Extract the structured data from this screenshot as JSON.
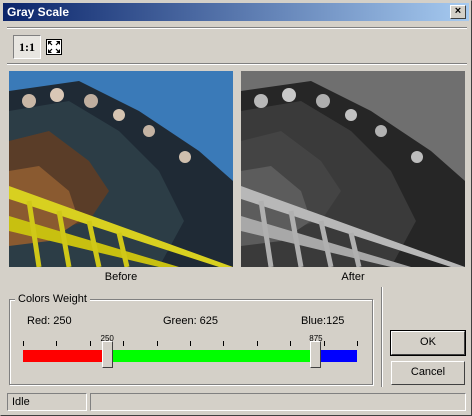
{
  "window": {
    "title": "Gray Scale",
    "close_glyph": "×"
  },
  "toolbar": {
    "actual_size_label": "1:1",
    "fit_icon": "fit-to-window-icon"
  },
  "images": {
    "before_label": "Before",
    "after_label": "After"
  },
  "colors_weight": {
    "title": "Colors Weight",
    "red_label": "Red: 250",
    "green_label": "Green: 625",
    "blue_label": "Blue:125",
    "thumb1_value": "250",
    "thumb2_value": "875",
    "red": 250,
    "green": 625,
    "blue": 125,
    "scale_max": 1000,
    "colors": {
      "red": "#ff0000",
      "green": "#00ff00",
      "blue": "#0000ff"
    }
  },
  "buttons": {
    "ok": "OK",
    "cancel": "Cancel"
  },
  "status": {
    "text": "Idle",
    "extra": ""
  }
}
